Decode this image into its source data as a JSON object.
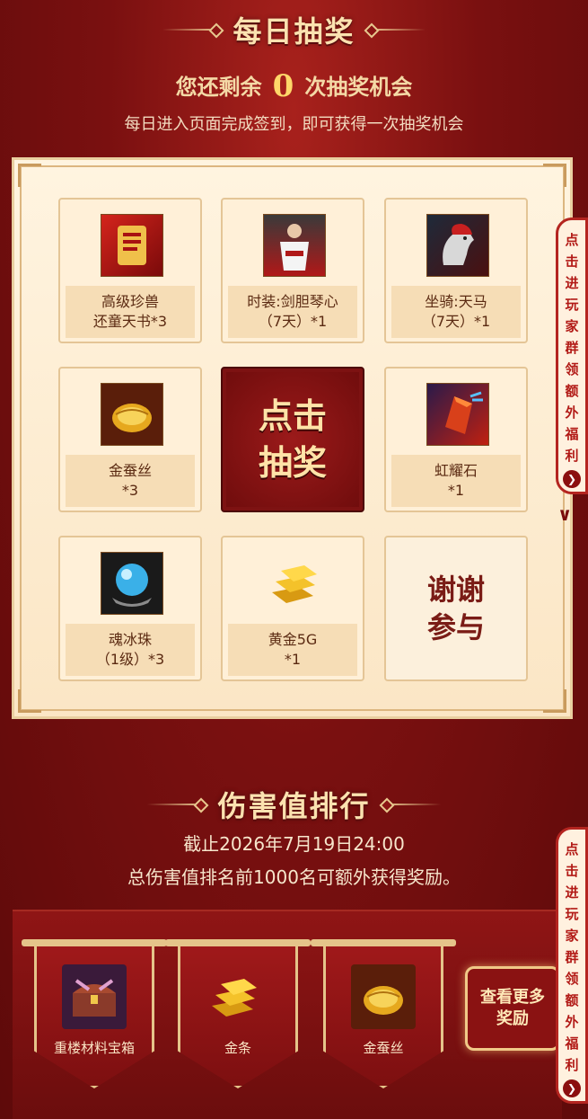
{
  "lottery": {
    "title": "每日抽奖",
    "remain_prefix": "您还剩余",
    "remain_count": "0",
    "remain_suffix": "次抽奖机会",
    "description": "每日进入页面完成签到，即可获得一次抽奖机会",
    "prizes": [
      {
        "line1": "高级珍兽",
        "line2": "还童天书*3",
        "icon": "scroll-icon"
      },
      {
        "line1": "时装:剑胆琴心",
        "line2": "（7天）*1",
        "icon": "costume-icon"
      },
      {
        "line1": "坐骑:天马",
        "line2": "（7天）*1",
        "icon": "horse-icon"
      },
      {
        "line1": "金蚕丝",
        "line2": "*3",
        "icon": "silk-icon"
      },
      {
        "line1": "虹耀石",
        "line2": "*1",
        "icon": "gem-icon"
      },
      {
        "line1": "魂冰珠",
        "line2": "（1级）*3",
        "icon": "orb-icon"
      },
      {
        "line1": "黄金5G",
        "line2": "*1",
        "icon": "gold-icon"
      }
    ],
    "draw_button_line1": "点击",
    "draw_button_line2": "抽奖",
    "thanks_line1": "谢谢",
    "thanks_line2": "参与"
  },
  "side_tab": {
    "chars": [
      "点",
      "击",
      "进",
      "玩",
      "家",
      "群",
      "领",
      "额",
      "外",
      "福",
      "利"
    ]
  },
  "ranking": {
    "title": "伤害值排行",
    "deadline": "截止2026年7月19日24:00",
    "extra": "总伤害值排名前1000名可额外获得奖励。",
    "rewards": [
      {
        "name": "重楼材料宝箱",
        "icon": "chest-icon"
      },
      {
        "name": "金条",
        "icon": "gold-bar-icon"
      },
      {
        "name": "金蚕丝",
        "icon": "silk-icon"
      }
    ],
    "more_line1": "查看更多",
    "more_line2": "奖励"
  },
  "colors": {
    "bg_red": "#7a1010",
    "gold": "#f4d9a6",
    "board_cream": "#fff4e0",
    "button_red": "#9b1a1a"
  }
}
